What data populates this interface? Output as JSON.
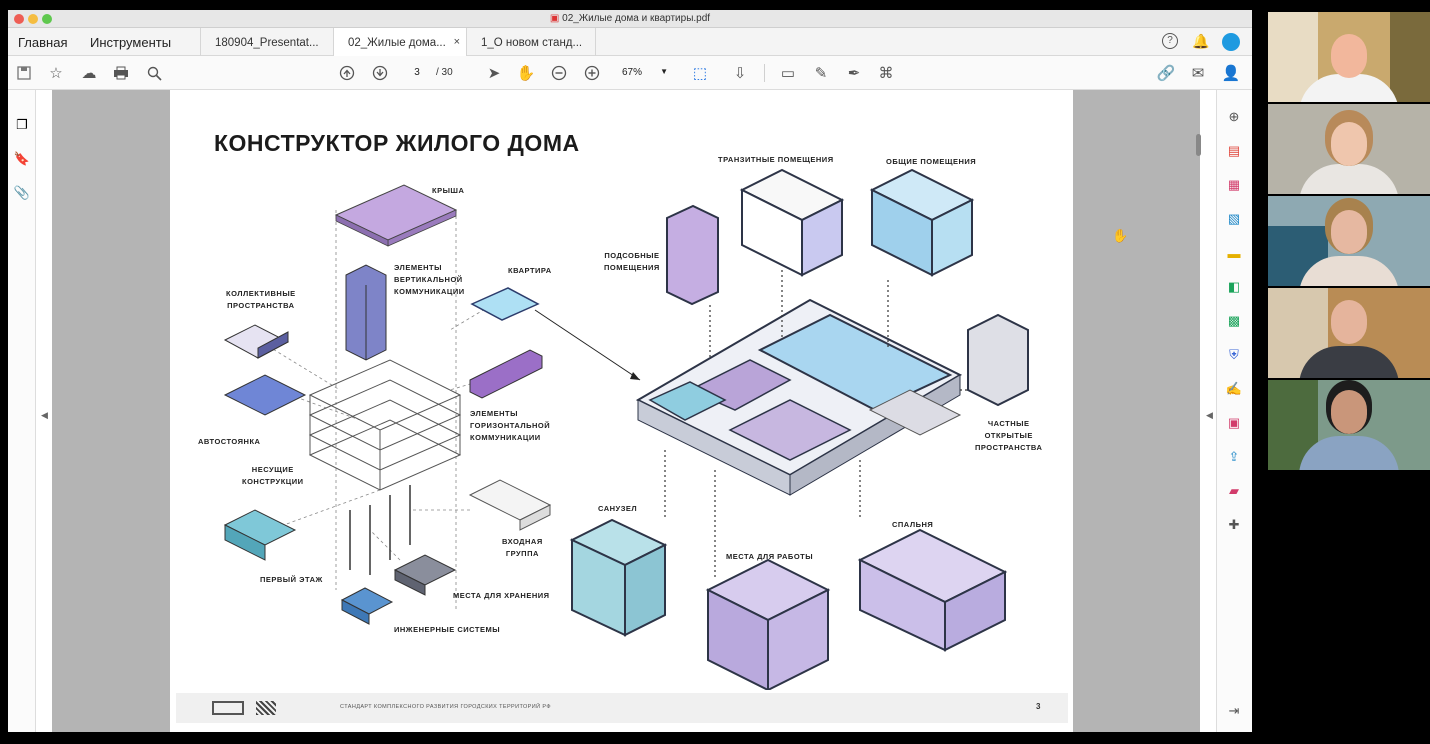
{
  "window": {
    "title": "02_Жилые дома и квартиры.pdf"
  },
  "menu": {
    "home": "Главная",
    "tools": "Инструменты"
  },
  "tabs": [
    {
      "label": "180904_Presentat..."
    },
    {
      "label": "02_Жилые дома...",
      "close": "×"
    },
    {
      "label": "1_О новом станд..."
    }
  ],
  "toolbar": {
    "page_current": "3",
    "page_total": "/ 30",
    "zoom": "67%"
  },
  "slide": {
    "title": "КОНСТРУКТОР ЖИЛОГО ДОМА",
    "labels": {
      "roof": "КРЫША",
      "vertical": [
        "ЭЛЕМЕНТЫ",
        "ВЕРТИКАЛЬНОЙ",
        "КОММУНИКАЦИИ"
      ],
      "collective": [
        "КОЛЛЕКТИВНЫЕ",
        "ПРОСТРАНСТВА"
      ],
      "apartment": "КВАРТИРА",
      "horizontal": [
        "ЭЛЕМЕНТЫ",
        "ГОРИЗОНТАЛЬНОЙ",
        "КОММУНИКАЦИИ"
      ],
      "parking": "АВТОСТОЯНКА",
      "structure": [
        "НЕСУЩИЕ",
        "КОНСТРУКЦИИ"
      ],
      "entry": [
        "ВХОДНАЯ",
        "ГРУППА"
      ],
      "first_floor": "ПЕРВЫЙ ЭТАЖ",
      "storage": "МЕСТА ДЛЯ ХРАНЕНИЯ",
      "engineering": "ИНЖЕНЕРНЫЕ СИСТЕМЫ",
      "transit": "ТРАНЗИТНЫЕ ПОМЕЩЕНИЯ",
      "common": "ОБЩИЕ ПОМЕЩЕНИЯ",
      "auxiliary": [
        "ПОДСОБНЫЕ",
        "ПОМЕЩЕНИЯ"
      ],
      "private_open": [
        "ЧАСТНЫЕ",
        "ОТКРЫТЫЕ",
        "ПРОСТРАНСТВА"
      ],
      "bathroom": "САНУЗЕЛ",
      "workplace": "МЕСТА ДЛЯ РАБОТЫ",
      "bedroom": "СПАЛЬНЯ"
    },
    "footer": "СТАНДАРТ КОМПЛЕКСНОГО РАЗВИТИЯ ГОРОДСКИХ ТЕРРИТОРИЙ РФ",
    "page_number": "3"
  },
  "colors": {
    "purple": "#b99ed6",
    "blue": "#9fd0ec",
    "slate": "#5f6f96",
    "dark": "#2d3447"
  }
}
